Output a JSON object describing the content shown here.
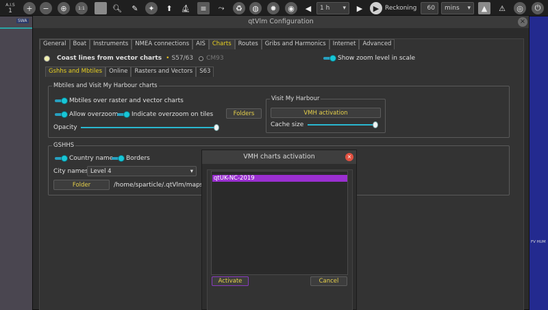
{
  "app_toolbar": {
    "ais_label": "A.I.S",
    "ais_value": "1",
    "zoom_level_value": "1:1",
    "time_step_value": "1 h",
    "reckoning_label": "Reckoning",
    "reckoning_value": "60",
    "reckoning_unit": "mins"
  },
  "map": {
    "left_label": "SWA",
    "right_label": "FV HUM",
    "accent_color": "#232a8f"
  },
  "config": {
    "window_title": "qtVlm Configuration",
    "tabs": [
      "General",
      "Boat",
      "Instruments",
      "NMEA connections",
      "AIS",
      "Charts",
      "Routes",
      "Gribs and Harmonics",
      "Internet",
      "Advanced"
    ],
    "active_tab": "Charts",
    "coastlines_label": "Coast lines from vector charts",
    "coastlines_opt1": "S57/63",
    "coastlines_opt2": "CM93",
    "show_zoom_label": "Show zoom level in scale",
    "sub_tabs": [
      "Gshhs and Mbtiles",
      "Online",
      "Rasters and Vectors",
      "S63"
    ],
    "active_sub_tab": "Gshhs and Mbtiles",
    "mbtiles": {
      "title": "Mbtiles and Visit My Harbour charts",
      "over_raster_label": "Mbtiles over raster and vector charts",
      "allow_overzoom_label": "Allow overzoom",
      "indicate_overzoom_label": "Indicate overzoom on tiles",
      "folders_button": "Folders",
      "opacity_label": "Opacity",
      "opacity_value": 1.0
    },
    "vmh": {
      "title": "Visit My Harbour",
      "activation_button": "VMH activation",
      "cache_label": "Cache size",
      "cache_value": 1.0
    },
    "gshhs": {
      "title": "GSHHS",
      "country_name_label": "Country name",
      "borders_label": "Borders",
      "city_names_label": "City names",
      "city_names_value": "Level 4",
      "folder_button": "Folder",
      "folder_path": "/home/sparticle/.qtVlm/maps/"
    }
  },
  "vmh_dialog": {
    "title": "VMH charts activation",
    "list_items": [
      "qtUK-NC-2019"
    ],
    "activate_button": "Activate",
    "cancel_button": "Cancel",
    "selection_color": "#9a2fd0"
  }
}
